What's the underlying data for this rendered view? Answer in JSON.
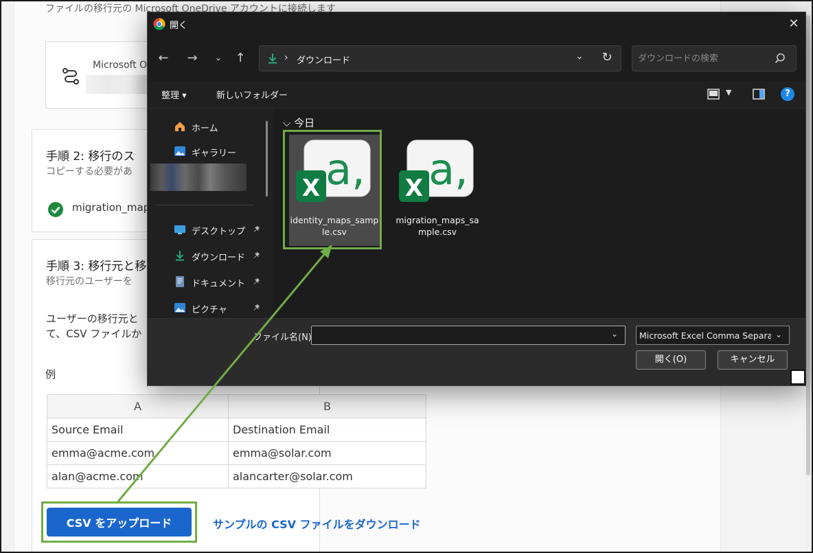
{
  "page": {
    "subtitle": "ファイルの移行元の Microsoft OneDrive アカウントに接続します",
    "source_card": {
      "name": "Microsoft O"
    },
    "step2": {
      "title": "手順 2: 移行のス",
      "desc": "コピーする必要があ",
      "file": "migration_map"
    },
    "step3": {
      "title": "手順 3: 移行元と移",
      "desc": "移行元のユーザーを",
      "body_line1": "ユーザーの移行元と",
      "body_line2": "て、CSV ファイルか"
    },
    "example_label": "例",
    "table": {
      "headers": [
        "A",
        "B"
      ],
      "rows": [
        [
          "Source Email",
          "Destination Email"
        ],
        [
          "emma@acme.com",
          "emma@solar.com"
        ],
        [
          "alan@acme.com",
          "alancarter@solar.com"
        ]
      ]
    },
    "upload_button": "CSV をアップロード",
    "sample_link": "サンプルの CSV ファイルをダウンロード"
  },
  "dialog": {
    "title": "開く",
    "address": {
      "separator": "›",
      "location": "ダウンロード"
    },
    "search_placeholder": "ダウンロードの検索",
    "commands": {
      "organize": "整理 ▾",
      "new_folder": "新しいフォルダー"
    },
    "sidebar": {
      "items": [
        {
          "label": "ホーム",
          "icon": "home-icon"
        },
        {
          "label": "ギャラリー",
          "icon": "gallery-icon"
        },
        {
          "label": "デスクトップ",
          "icon": "desktop-icon",
          "pinned": true
        },
        {
          "label": "ダウンロード",
          "icon": "download-icon",
          "pinned": true
        },
        {
          "label": "ドキュメント",
          "icon": "document-icon",
          "pinned": true
        },
        {
          "label": "ピクチャ",
          "icon": "picture-icon",
          "pinned": true
        }
      ]
    },
    "group_header": "今日",
    "files": [
      {
        "name": "identity_maps_sample.csv",
        "selected": true
      },
      {
        "name": "migration_maps_sample.csv",
        "selected": false
      }
    ],
    "file_name_label": "ファイル名(N):",
    "file_name_value": "",
    "file_type": "Microsoft Excel Comma Separat",
    "open_button": "開く(O)",
    "cancel_button": "キャンセル"
  },
  "colors": {
    "accent_blue": "#1a66cc",
    "highlight_green": "#70ad47",
    "excel_green": "#107c41"
  }
}
